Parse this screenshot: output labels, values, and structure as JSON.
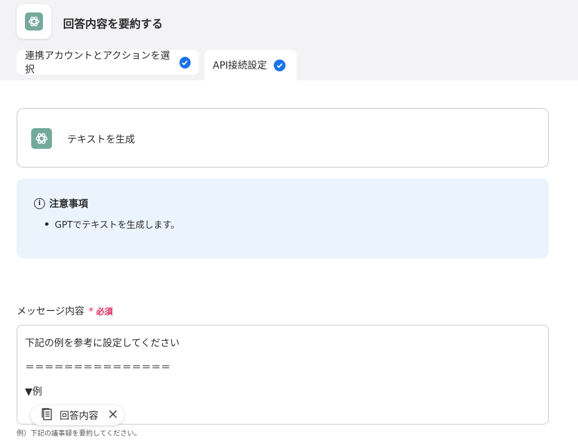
{
  "header": {
    "title": "回答内容を要約する",
    "app_icon": "openai-icon",
    "accent": "#74aa9c"
  },
  "tabs": [
    {
      "label": "連携アカウントとアクションを選択",
      "completed": true
    },
    {
      "label": "API接続設定",
      "completed": true
    }
  ],
  "action": {
    "label": "テキストを生成",
    "icon": "openai-icon"
  },
  "notice": {
    "title": "注意事項",
    "items": [
      "GPTでテキストを生成します。"
    ],
    "background": "#ebf4fc"
  },
  "message_field": {
    "label": "メッセージ内容",
    "required_mark": "*",
    "required_text": "必須",
    "lines": [
      "下記の例を参考に設定してください",
      "＝＝＝＝＝＝＝＝＝＝＝＝＝＝＝",
      "▼例"
    ],
    "chip": {
      "label": "回答内容",
      "icon": "document-icon"
    },
    "hint": "例）下記の議事録を要約してください。"
  },
  "colors": {
    "check": "#1a73e8",
    "required": "#e0245e"
  }
}
